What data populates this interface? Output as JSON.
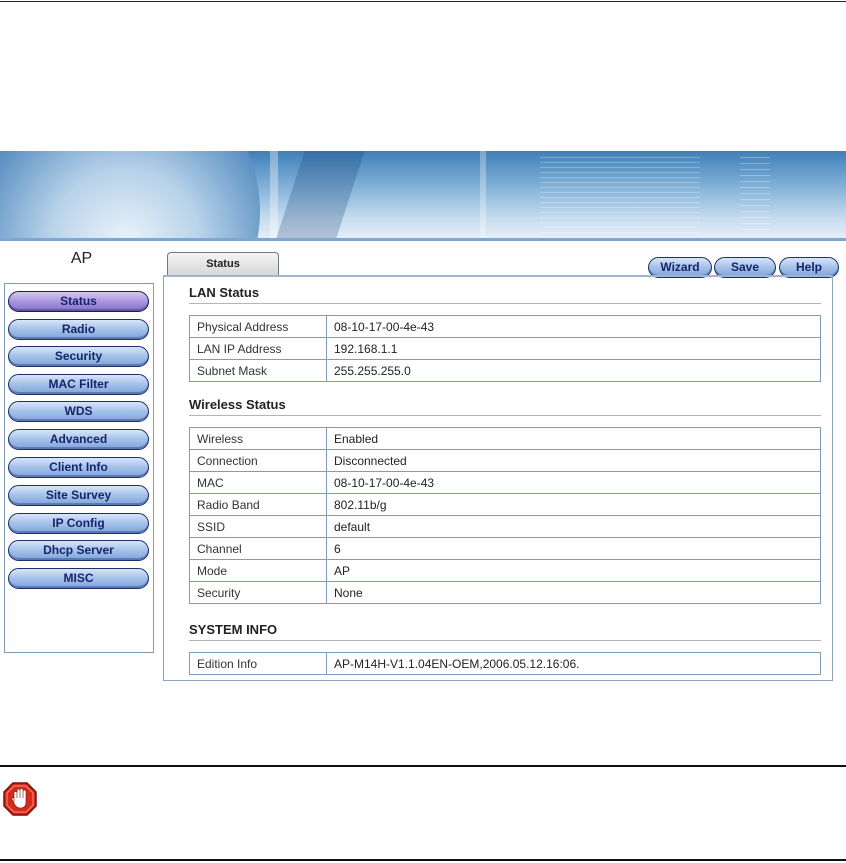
{
  "sidebar": {
    "title": "AP",
    "items": [
      {
        "label": "Status",
        "active": true
      },
      {
        "label": "Radio"
      },
      {
        "label": "Security"
      },
      {
        "label": "MAC Filter"
      },
      {
        "label": "WDS"
      },
      {
        "label": "Advanced"
      },
      {
        "label": "Client Info"
      },
      {
        "label": "Site Survey"
      },
      {
        "label": "IP Config"
      },
      {
        "label": "Dhcp Server"
      },
      {
        "label": "MISC"
      }
    ]
  },
  "tabs": [
    {
      "label": "Status"
    }
  ],
  "toolbar": {
    "wizard_label": "Wizard",
    "save_label": "Save",
    "help_label": "Help"
  },
  "lan": {
    "title": "LAN Status",
    "rows": [
      {
        "key": "Physical Address",
        "value": "08-10-17-00-4e-43"
      },
      {
        "key": "LAN IP Address",
        "value": "192.168.1.1"
      },
      {
        "key": "Subnet Mask",
        "value": "255.255.255.0"
      }
    ]
  },
  "wireless": {
    "title": "Wireless Status",
    "rows": [
      {
        "key": "Wireless",
        "value": "Enabled"
      },
      {
        "key": "Connection",
        "value": "Disconnected"
      },
      {
        "key": "MAC",
        "value": "08-10-17-00-4e-43"
      },
      {
        "key": "Radio Band",
        "value": "802.11b/g"
      },
      {
        "key": "SSID",
        "value": "default"
      },
      {
        "key": "Channel",
        "value": "6"
      },
      {
        "key": "Mode",
        "value": "AP"
      },
      {
        "key": "Security",
        "value": "None"
      }
    ]
  },
  "system": {
    "title": "SYSTEM INFO",
    "rows": [
      {
        "key": "Edition Info",
        "value": "AP-M14H-V1.1.04EN-OEM,2006.05.12.16:06."
      }
    ]
  },
  "colors": {
    "nav_button": "#a8c4ea",
    "nav_active": "#a996de",
    "border": "#7f9db9",
    "stop_icon": "#d42a1c"
  },
  "icons": {
    "notice": "stop-hand-icon"
  }
}
